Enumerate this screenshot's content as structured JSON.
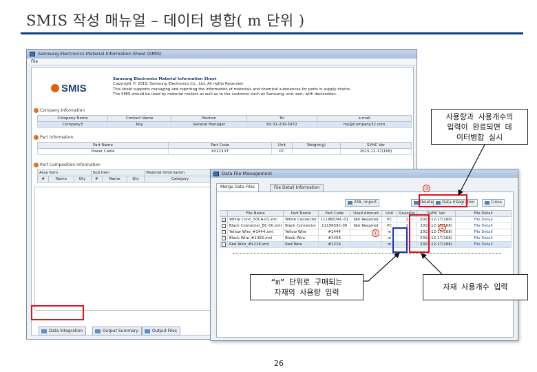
{
  "slide": {
    "title": "SMIS 작성 매뉴얼 – 데이터 병합( m 단위 )",
    "page_number": "26",
    "accent_color": "#0a3b86",
    "highlight_color": "#e0101a"
  },
  "main_window": {
    "title": "Samsung Electronics Material Information Sheet (SMIS)",
    "menu": "File",
    "logo_text": "SMIS",
    "header_lines": [
      "Samsung Electronics Material Information Sheet",
      "Copyright © 2015, Samsung Electronics Co., Ltd. All rights Reserved.",
      "This sheet supports managing and reporting the information of materials and chemical substances for parts in supply chains.",
      "The SMIS should be used by material makers as well as to the customer such as Samsung, end user, with declaration."
    ],
    "company_section": {
      "title": "Company Information",
      "columns": [
        "Company Name",
        "Contact Name",
        "Position",
        "Tel",
        "e-mail"
      ],
      "row": [
        "Company3",
        "Roy",
        "General Manager",
        "82-31-200-5972",
        "my@Company32.com"
      ]
    },
    "part_section": {
      "title": "Part Information",
      "columns": [
        "Part Name",
        "Part Code",
        "Unit",
        "Weight(g)",
        "SVHC Ver"
      ],
      "row": [
        "Power Cable",
        "X0123-YT",
        "PC",
        "",
        "2015-12-17(168)"
      ]
    },
    "composition_section": {
      "title": "Part Composition Information",
      "group_headers": [
        "Assy Item",
        "Sub Item",
        "Material Information"
      ],
      "columns": [
        "#",
        "Name",
        "Qty",
        "#",
        "Name",
        "Qty",
        "Category"
      ]
    },
    "bottom_tabs": [
      "Data Integration",
      "Output Summary",
      "Output Files"
    ]
  },
  "data_window": {
    "title": "Data File Management",
    "tabs": [
      "Merge Data Files",
      "File Detail Information"
    ],
    "buttons": [
      "XML Import",
      "Delete",
      "Data Integration",
      "Close"
    ],
    "columns": [
      "",
      "File Name",
      "Part Name",
      "Part Code",
      "Used Amount",
      "Unit",
      "Quantity",
      "SVHC Ver",
      "File Detail"
    ],
    "rows": [
      {
        "file": "White Conn_50CA-01.xml",
        "part": "White Connector",
        "code": "1119667AC-01",
        "amount": "Not Required",
        "unit": "PC",
        "qty": "1",
        "svhc": "2015-12-17(168)",
        "detail": "File Detail"
      },
      {
        "file": "Black Connector_BC-00.xml",
        "part": "Black Connector",
        "code": "1119659C-00",
        "amount": "Not Required",
        "unit": "PC",
        "qty": "1",
        "svhc": "2015-12-17(168)",
        "detail": "File Detail"
      },
      {
        "file": "Yellow Wire_#1444.xml",
        "part": "Yellow Wire",
        "code": "#1444",
        "amount": "",
        "unit": "m",
        "qty": "1",
        "svhc": "2015-12-17(168)",
        "detail": "File Detail"
      },
      {
        "file": "Black Wire_#1456.xml",
        "part": "Black Wire",
        "code": "#1456",
        "amount": "",
        "unit": "m",
        "qty": "2",
        "svhc": "2015-12-17(168)",
        "detail": "File Detail"
      },
      {
        "file": "Red Wire_#1216.xml",
        "part": "Red Wire",
        "code": "#1216",
        "amount": "",
        "unit": "m",
        "qty": "2",
        "svhc": "2015-12-17(168)",
        "detail": "File Detail"
      }
    ]
  },
  "annotations": {
    "callout_top_right": [
      "사용량과 사용개수의",
      "입력이 완료되면 데",
      "이터병합 실시"
    ],
    "callout_bottom_left": [
      "“m” 단위로 구매되는",
      "자재의 사용량 입력"
    ],
    "callout_bottom_right": "자재 사용개수 입력",
    "marker_1": "①",
    "marker_2": "②",
    "marker_3": "③"
  }
}
